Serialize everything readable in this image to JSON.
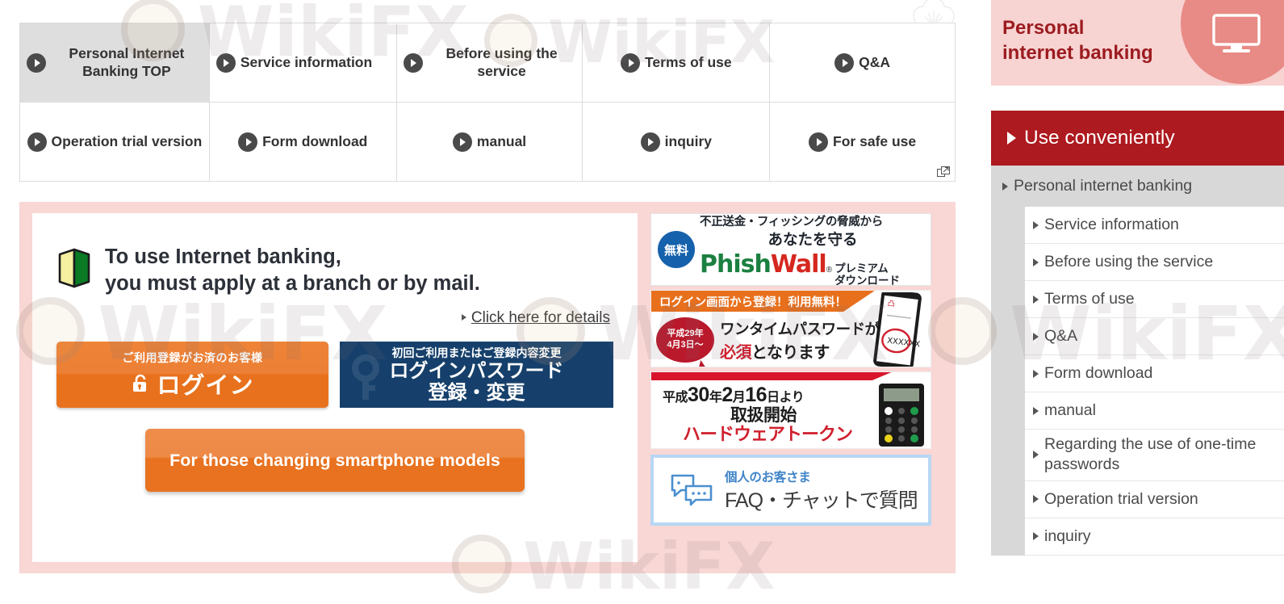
{
  "nav_table": {
    "rows": [
      [
        {
          "label": "Personal Internet Banking TOP",
          "icon": "circle-play-icon",
          "current": true,
          "align": "center"
        },
        {
          "label": "Service information",
          "icon": "circle-play-icon",
          "current": false,
          "align": "left"
        },
        {
          "label": "Before using the service",
          "icon": "circle-play-icon",
          "current": false,
          "align": "left"
        },
        {
          "label": "Terms of use",
          "icon": "circle-play-icon",
          "current": false,
          "align": "center"
        },
        {
          "label": "Q&A",
          "icon": "circle-play-icon",
          "current": false,
          "align": "center"
        }
      ],
      [
        {
          "label": "Operation trial version",
          "icon": "circle-play-icon",
          "current": false,
          "align": "center"
        },
        {
          "label": "Form download",
          "icon": "circle-play-icon",
          "current": false,
          "align": "center"
        },
        {
          "label": "manual",
          "icon": "circle-play-icon",
          "current": false,
          "align": "center"
        },
        {
          "label": "inquiry",
          "icon": "circle-play-icon",
          "current": false,
          "align": "center"
        },
        {
          "label": "For safe use",
          "icon": "circle-play-icon",
          "current": false,
          "align": "center",
          "external": true
        }
      ]
    ]
  },
  "main": {
    "headline_line1": "To use Internet banking,",
    "headline_line2": "you must apply at a branch or by mail.",
    "beginner_icon": "beginner-mark-icon",
    "details_link": "Click here for details",
    "login_button": {
      "sub": "ご利用登録がお済のお客様",
      "main": "ログイン",
      "icon": "unlocked-padlock-icon"
    },
    "password_button": {
      "sub": "初回ご利用またはご登録内容変更",
      "line1": "ログインパスワード",
      "line2": "登録・変更",
      "icon": "key-icon"
    },
    "smartphone_button": "For those changing smartphone models"
  },
  "banners": {
    "phishwall": {
      "free_badge": "無料",
      "line1": "不正送金・フィッシングの脅威から",
      "line2": "あなたを守る",
      "logo_part1": "Phish",
      "logo_part2": "Wall",
      "registered": "®",
      "tag1": "プレミアム",
      "tag2": "ダウンロード"
    },
    "onetime": {
      "header": "ログイン画面から登録！利用無料！",
      "bubble_line1": "平成29年",
      "bubble_line2": "4月3日〜",
      "line1": "ワンタイムパスワードが",
      "line2_red": "必須",
      "line2_rest": "となります",
      "phone_code": "XXXXXX"
    },
    "token": {
      "line1_prefix": "平成",
      "line1_n1": "30",
      "line1_mid1": "年",
      "line1_n2": "2",
      "line1_mid2": "月",
      "line1_n3": "16",
      "line1_suffix": "日より",
      "line2": "取扱開始",
      "line3": "ハードウェアトークン"
    },
    "faq": {
      "icon": "chat-bubbles-icon",
      "line1": "個人のお客さま",
      "line2": "FAQ・チャットで質問"
    }
  },
  "sidebar": {
    "hero_line1": "Personal",
    "hero_line2": "internet banking",
    "hero_icon": "monitor-icon",
    "section_bar": "Use conveniently",
    "top_item": "Personal internet banking",
    "sub_items": [
      {
        "label": "Service information"
      },
      {
        "label": "Before using the service"
      },
      {
        "label": "Terms of use"
      },
      {
        "label": "Q&A"
      },
      {
        "label": "Form download"
      },
      {
        "label": "manual"
      },
      {
        "label": "Regarding the use of one-time passwords",
        "two_line": true
      },
      {
        "label": "Operation trial version"
      },
      {
        "label": "inquiry"
      }
    ]
  },
  "watermark": {
    "text": "WikiFX"
  }
}
